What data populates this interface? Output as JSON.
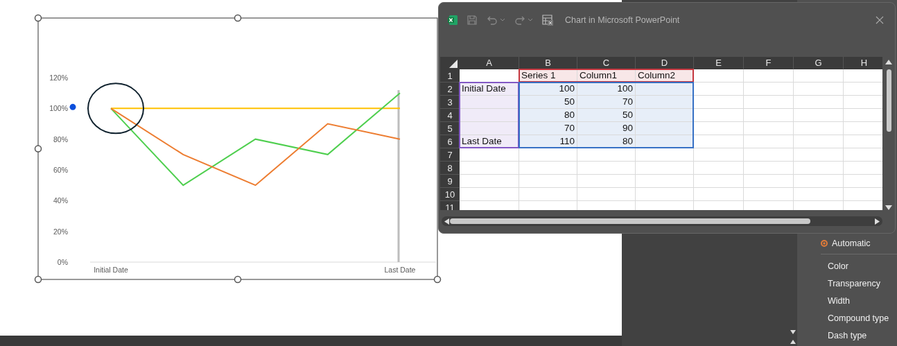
{
  "slide": {
    "chart": {
      "chart_data": {
        "type": "line",
        "categories": [
          "Initial Date",
          null,
          null,
          null,
          "Last Date"
        ],
        "ylim": [
          0,
          1.2
        ],
        "yticks": [
          {
            "value": 0,
            "label": "0%"
          },
          {
            "value": 0.2,
            "label": "20%"
          },
          {
            "value": 0.4,
            "label": "40%"
          },
          {
            "value": 0.6,
            "label": "60%"
          },
          {
            "value": 0.8,
            "label": "80%"
          },
          {
            "value": 1,
            "label": "100%"
          },
          {
            "value": 1.2,
            "label": "120%"
          }
        ],
        "series": [
          {
            "color": "#ffc000",
            "values": [
              1,
              1,
              1,
              1,
              1
            ]
          },
          {
            "color": "#4fcf4f",
            "values": [
              1,
              0.5,
              0.8,
              0.7,
              1.1
            ]
          },
          {
            "color": "#ed7d31",
            "values": [
              1,
              0.7,
              0.5,
              0.9,
              0.8
            ]
          }
        ]
      }
    }
  },
  "format_pane": {
    "items": [
      {
        "kind": "radio",
        "label": "Automatic",
        "selected": true
      },
      {
        "kind": "divider"
      },
      {
        "kind": "label",
        "label": "Color"
      },
      {
        "kind": "label",
        "label": "Transparency"
      },
      {
        "kind": "label",
        "label": "Width"
      },
      {
        "kind": "label",
        "label": "Compound type"
      },
      {
        "kind": "label",
        "label": "Dash type"
      }
    ]
  },
  "spreadsheet_window": {
    "title": "Chart in Microsoft PowerPoint",
    "toolbar": [
      {
        "kind": "app",
        "disabled": false
      },
      {
        "kind": "save",
        "disabled": true
      },
      {
        "kind": "undo",
        "disabled": true
      },
      {
        "kind": "redo",
        "disabled": true
      },
      {
        "kind": "table",
        "disabled": false
      }
    ],
    "columns": [
      "A",
      "B",
      "C",
      "D",
      "E",
      "F",
      "G",
      "H"
    ],
    "rows": [
      {
        "header": "1",
        "cells": [
          {
            "text": ""
          },
          {
            "text": "Series 1",
            "color": "#f8e7e8"
          },
          {
            "text": "Column1",
            "color": "#f8e7e8"
          },
          {
            "text": "Column2",
            "color": "#f8e7e8"
          },
          {
            "text": ""
          },
          {
            "text": ""
          },
          {
            "text": ""
          },
          {
            "text": ""
          }
        ]
      },
      {
        "header": "2",
        "cells": [
          {
            "text": "Initial Date",
            "color": "#f0ebf8"
          },
          {
            "text": "100",
            "color": "#e7eef8",
            "kind": "number"
          },
          {
            "text": "100",
            "color": "#e7eef8",
            "kind": "number"
          },
          {
            "text": "",
            "color": "#e7eef8"
          },
          {
            "text": ""
          },
          {
            "text": ""
          },
          {
            "text": ""
          },
          {
            "text": ""
          }
        ]
      },
      {
        "header": "3",
        "cells": [
          {
            "text": "",
            "color": "#f0ebf8"
          },
          {
            "text": "50",
            "color": "#e7eef8",
            "kind": "number"
          },
          {
            "text": "70",
            "color": "#e7eef8",
            "kind": "number"
          },
          {
            "text": "",
            "color": "#e7eef8"
          },
          {
            "text": ""
          },
          {
            "text": ""
          },
          {
            "text": ""
          },
          {
            "text": ""
          }
        ]
      },
      {
        "header": "4",
        "cells": [
          {
            "text": "",
            "color": "#f0ebf8"
          },
          {
            "text": "80",
            "color": "#e7eef8",
            "kind": "number"
          },
          {
            "text": "50",
            "color": "#e7eef8",
            "kind": "number"
          },
          {
            "text": "",
            "color": "#e7eef8"
          },
          {
            "text": ""
          },
          {
            "text": ""
          },
          {
            "text": ""
          },
          {
            "text": ""
          }
        ]
      },
      {
        "header": "5",
        "cells": [
          {
            "text": "",
            "color": "#f0ebf8"
          },
          {
            "text": "70",
            "color": "#e7eef8",
            "kind": "number"
          },
          {
            "text": "90",
            "color": "#e7eef8",
            "kind": "number"
          },
          {
            "text": "",
            "color": "#e7eef8"
          },
          {
            "text": ""
          },
          {
            "text": ""
          },
          {
            "text": ""
          },
          {
            "text": ""
          }
        ]
      },
      {
        "header": "6",
        "cells": [
          {
            "text": "Last Date",
            "color": "#f0ebf8"
          },
          {
            "text": "110",
            "color": "#e7eef8",
            "kind": "number"
          },
          {
            "text": "80",
            "color": "#e7eef8",
            "kind": "number"
          },
          {
            "text": "",
            "color": "#e7eef8"
          },
          {
            "text": ""
          },
          {
            "text": ""
          },
          {
            "text": ""
          },
          {
            "text": ""
          }
        ]
      },
      {
        "header": "7",
        "cells": [
          {
            "text": ""
          },
          {
            "text": ""
          },
          {
            "text": ""
          },
          {
            "text": ""
          },
          {
            "text": ""
          },
          {
            "text": ""
          },
          {
            "text": ""
          },
          {
            "text": ""
          }
        ]
      },
      {
        "header": "8",
        "cells": [
          {
            "text": ""
          },
          {
            "text": ""
          },
          {
            "text": ""
          },
          {
            "text": ""
          },
          {
            "text": ""
          },
          {
            "text": ""
          },
          {
            "text": ""
          },
          {
            "text": ""
          }
        ]
      },
      {
        "header": "9",
        "cells": [
          {
            "text": ""
          },
          {
            "text": ""
          },
          {
            "text": ""
          },
          {
            "text": ""
          },
          {
            "text": ""
          },
          {
            "text": ""
          },
          {
            "text": ""
          },
          {
            "text": ""
          }
        ]
      },
      {
        "header": "10",
        "cells": [
          {
            "text": ""
          },
          {
            "text": ""
          },
          {
            "text": ""
          },
          {
            "text": ""
          },
          {
            "text": ""
          },
          {
            "text": ""
          },
          {
            "text": ""
          },
          {
            "text": ""
          }
        ]
      },
      {
        "header": "11",
        "cells": [
          {
            "text": ""
          },
          {
            "text": ""
          },
          {
            "text": ""
          },
          {
            "text": ""
          },
          {
            "text": ""
          },
          {
            "text": ""
          },
          {
            "text": ""
          },
          {
            "text": ""
          }
        ]
      }
    ]
  }
}
